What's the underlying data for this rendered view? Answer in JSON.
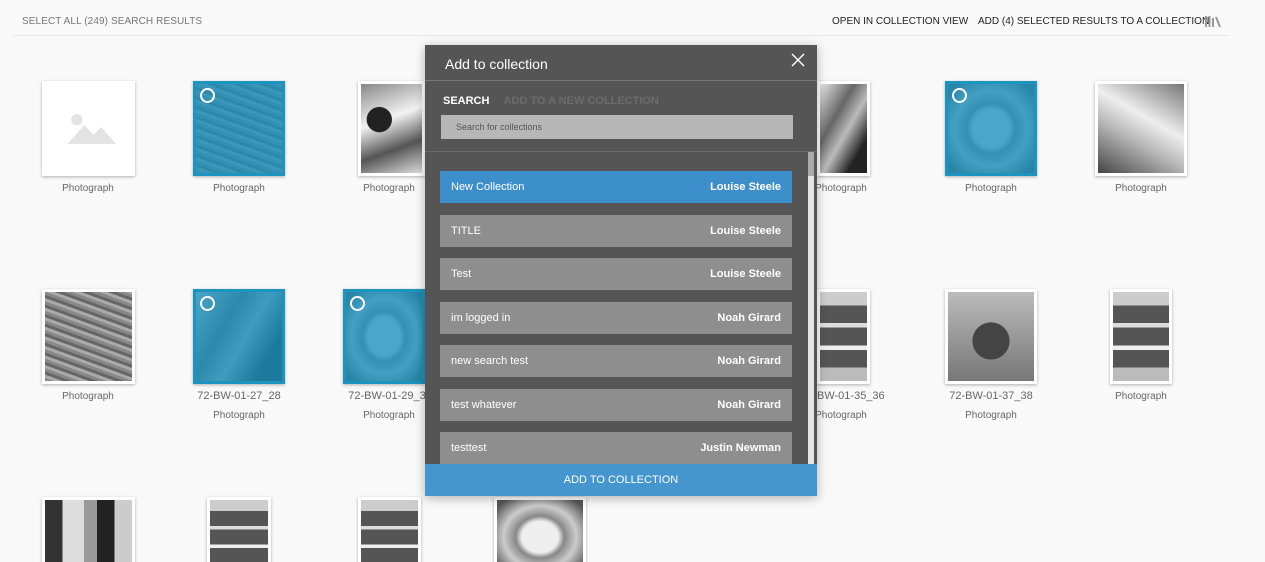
{
  "topbar": {
    "select_all": "SELECT ALL (249) SEARCH RESULTS",
    "open_view": "OPEN IN COLLECTION VIEW",
    "add_selected": "ADD (4) SELECTED RESULTS TO A COLLECTION",
    "icon": "library-icon"
  },
  "grid": {
    "row1": [
      {
        "caption": "Photograph",
        "selected": false
      },
      {
        "caption": "Photograph",
        "selected": true
      },
      {
        "caption": "Photograph",
        "selected": false
      },
      {
        "caption": "Photograph",
        "selected": false
      },
      {
        "caption": "Photograph",
        "selected": true
      },
      {
        "caption": "Photograph",
        "selected": false
      }
    ],
    "row2": [
      {
        "caption": "Photograph",
        "title": "",
        "selected": false
      },
      {
        "caption": "Photograph",
        "title": "72-BW-01-27_28",
        "selected": true
      },
      {
        "caption": "Photograph",
        "title": "72-BW-01-29_3",
        "selected": true
      },
      {
        "caption": "Photograph",
        "title": "-BW-01-35_36",
        "selected": false
      },
      {
        "caption": "Photograph",
        "title": "72-BW-01-37_38",
        "selected": false
      },
      {
        "caption": "Photograph",
        "title": "",
        "selected": false
      }
    ]
  },
  "modal": {
    "title": "Add to collection",
    "tab_search": "SEARCH",
    "tab_new": "ADD TO A NEW COLLECTION",
    "search_placeholder": "Search for collections",
    "items": [
      {
        "name": "New Collection",
        "owner": "Louise Steele",
        "active": true
      },
      {
        "name": "TITLE",
        "owner": "Louise Steele",
        "active": false
      },
      {
        "name": "Test",
        "owner": "Louise Steele",
        "active": false
      },
      {
        "name": "im logged in",
        "owner": "Noah Girard",
        "active": false
      },
      {
        "name": "new search test",
        "owner": "Noah Girard",
        "active": false
      },
      {
        "name": "test whatever",
        "owner": "Noah Girard",
        "active": false
      },
      {
        "name": "testtest",
        "owner": "Justin Newman",
        "active": false
      }
    ],
    "add_button": "ADD TO COLLECTION",
    "colors": {
      "active_row": "#3d8fcc",
      "row": "#8e8e8e",
      "panel": "#555555",
      "button": "#4596ce",
      "selected_overlay": "#1d93bf"
    }
  }
}
